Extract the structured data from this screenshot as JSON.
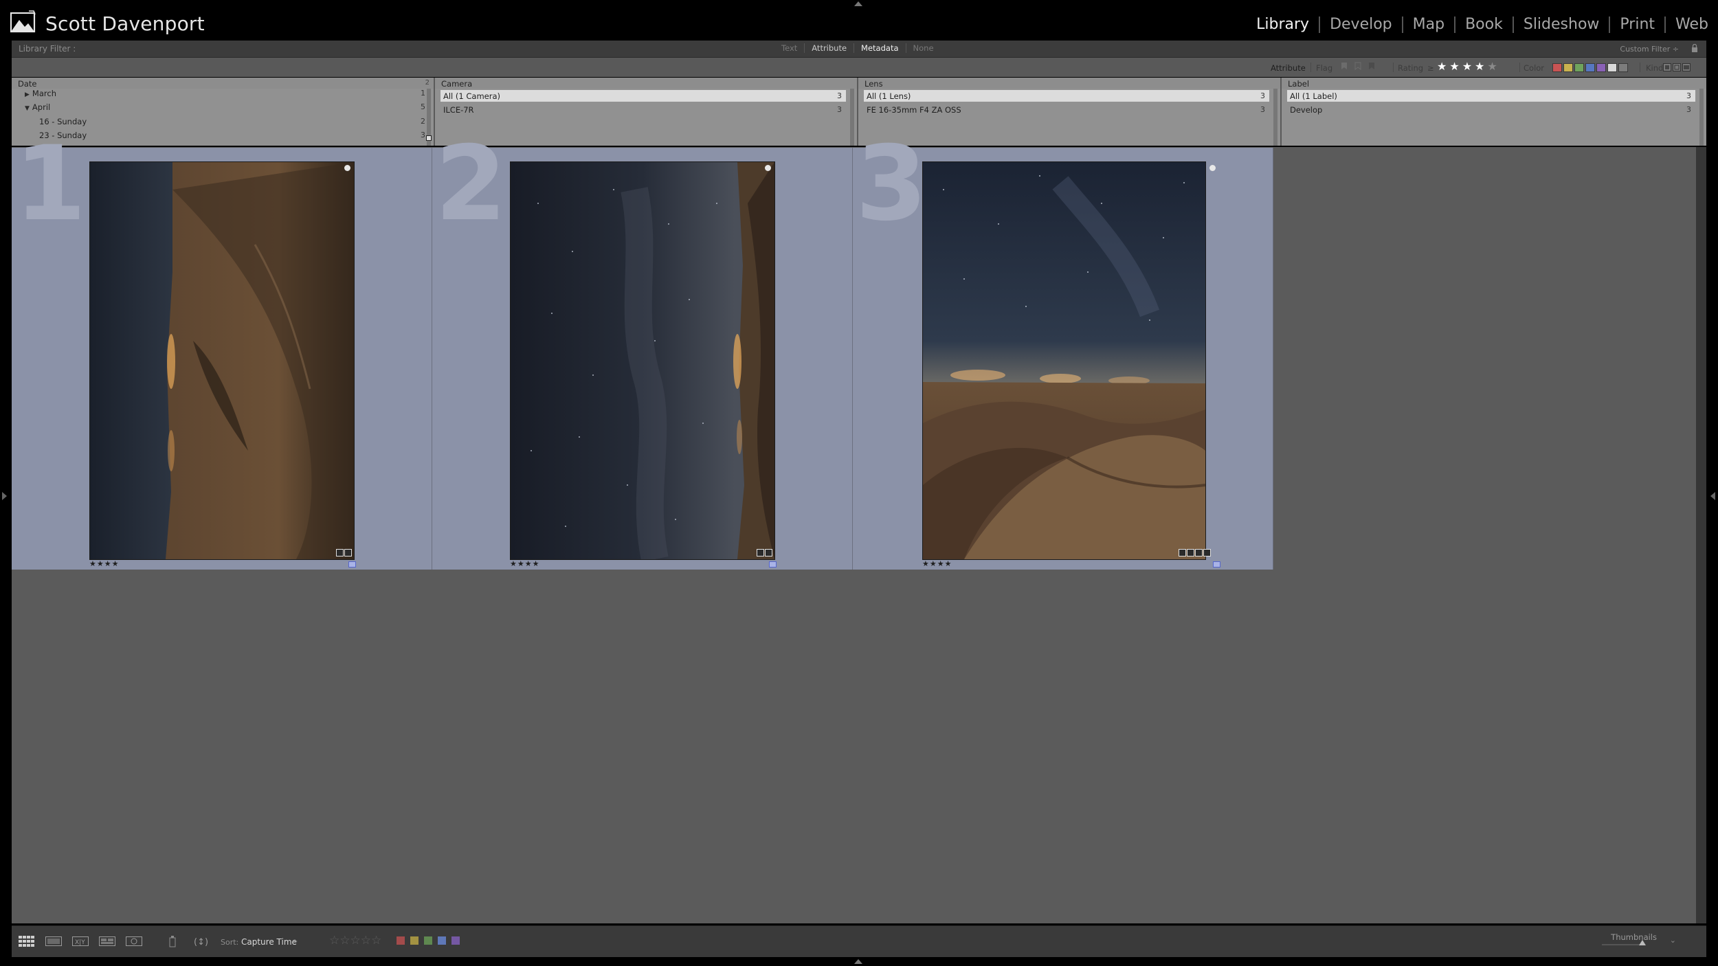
{
  "identity": {
    "name": "Scott Davenport"
  },
  "modules": [
    "Library",
    "Develop",
    "Map",
    "Book",
    "Slideshow",
    "Print",
    "Web"
  ],
  "active_module": "Library",
  "filter_bar": {
    "title": "Library Filter :",
    "tabs": [
      {
        "label": "Text",
        "state": "dim"
      },
      {
        "label": "Attribute",
        "state": "normal"
      },
      {
        "label": "Metadata",
        "state": "active"
      },
      {
        "label": "None",
        "state": "dim"
      }
    ],
    "preset": "Custom Filter ÷"
  },
  "attribute_bar": {
    "title": "Attribute",
    "flag_label": "Flag",
    "rating_label": "Rating",
    "rating_operator": "≥",
    "rating_value": 4,
    "rating_max": 5,
    "color_label": "Color",
    "kind_label": "Kind",
    "colors": [
      "#c95454",
      "#c9b24f",
      "#6fa35d",
      "#5777c0",
      "#8a61b6",
      "#d9d9d9",
      "#7c7c7c"
    ]
  },
  "metadata_browser": {
    "date": {
      "header": "Date",
      "header_count": "2",
      "rows": [
        {
          "label": "March",
          "count": "1",
          "expanded": false,
          "level": 0
        },
        {
          "label": "April",
          "count": "5",
          "expanded": true,
          "level": 0
        },
        {
          "label": "16 - Sunday",
          "count": "2",
          "level": 1
        },
        {
          "label": "23 - Sunday",
          "count": "3",
          "level": 1
        }
      ]
    },
    "camera": {
      "header": "Camera",
      "rows": [
        {
          "label": "All (1 Camera)",
          "count": "3",
          "selected": true
        },
        {
          "label": "ILCE-7R",
          "count": "3",
          "selected": false
        }
      ]
    },
    "lens": {
      "header": "Lens",
      "rows": [
        {
          "label": "All (1 Lens)",
          "count": "3",
          "selected": true
        },
        {
          "label": "FE 16-35mm F4 ZA OSS",
          "count": "3",
          "selected": false
        }
      ]
    },
    "label": {
      "header": "Label",
      "rows": [
        {
          "label": "All (1 Label)",
          "count": "3",
          "selected": true
        },
        {
          "label": "Develop",
          "count": "3",
          "selected": false
        }
      ]
    }
  },
  "grid": {
    "cells": [
      {
        "index": "1",
        "rating": 4,
        "stars": "★★★★",
        "orientation": "rotated-left",
        "selected": true
      },
      {
        "index": "2",
        "rating": 4,
        "stars": "★★★★",
        "orientation": "rotated-right",
        "selected": true
      },
      {
        "index": "3",
        "rating": 4,
        "stars": "★★★★",
        "orientation": "upright",
        "selected": true
      }
    ]
  },
  "toolbar": {
    "sort_label": "Sort:",
    "sort_value": "Capture Time",
    "sort_arrow": "÷",
    "thumbnails_label": "Thumbnails",
    "rating_stars": "☆☆☆☆☆",
    "colors": [
      "#a34b4b",
      "#a39242",
      "#5f8850",
      "#5f78b8",
      "#7558a3"
    ]
  }
}
